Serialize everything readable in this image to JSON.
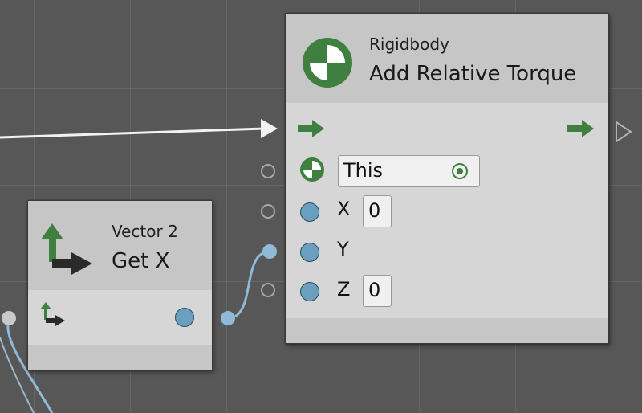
{
  "graph": {
    "nodes": {
      "add_relative_torque": {
        "subtitle": "Rigidbody",
        "title": "Add Relative Torque",
        "icon": "rigidbody-icon",
        "inputs": {
          "target": {
            "value": "This",
            "icon": "rigidbody-icon",
            "picker_icon": "target-picker-icon"
          },
          "x": {
            "label": "X",
            "value": "0"
          },
          "y": {
            "label": "Y"
          },
          "z": {
            "label": "Z",
            "value": "0"
          }
        },
        "control": {
          "icon": "flow-arrow-icon"
        }
      },
      "vector2_get_x": {
        "subtitle": "Vector 2",
        "title": "Get X",
        "icon": "vector2-axes-icon"
      }
    },
    "colors": {
      "background": "#575757",
      "node_body": "#d6d6d6",
      "node_header": "#c6c6c6",
      "value_port": "#6a9fbf",
      "flow_arrow": "#3f7f3f",
      "wire_control": "#f2f2f2",
      "wire_value": "#8fb9d6"
    }
  }
}
